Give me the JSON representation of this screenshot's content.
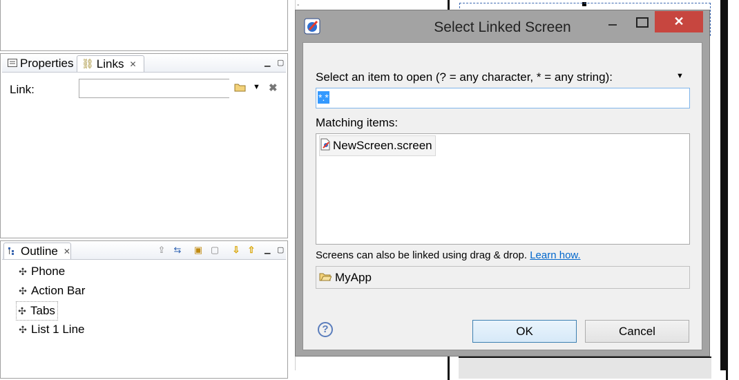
{
  "properties_view": {
    "tab_properties": "Properties",
    "tab_links": "Links",
    "link_label": "Link:",
    "link_value": ""
  },
  "outline_view": {
    "tab_label": "Outline",
    "items": [
      "Phone",
      "Action Bar",
      "Tabs",
      "List 1 Line"
    ]
  },
  "dialog": {
    "title": "Select Linked Screen",
    "prompt": "Select an item to open (? = any character, * = any string):",
    "filter_value": "*.*",
    "matching_label": "Matching items:",
    "matching_items": [
      "NewScreen.screen"
    ],
    "dnd_hint": "Screens can also be linked using drag & drop.",
    "learn_how": "Learn how.",
    "project": "MyApp",
    "ok_label": "OK",
    "cancel_label": "Cancel"
  },
  "colors": {
    "close_button": "#c7463f",
    "selection": "#3399ff",
    "link": "#0066cc"
  }
}
